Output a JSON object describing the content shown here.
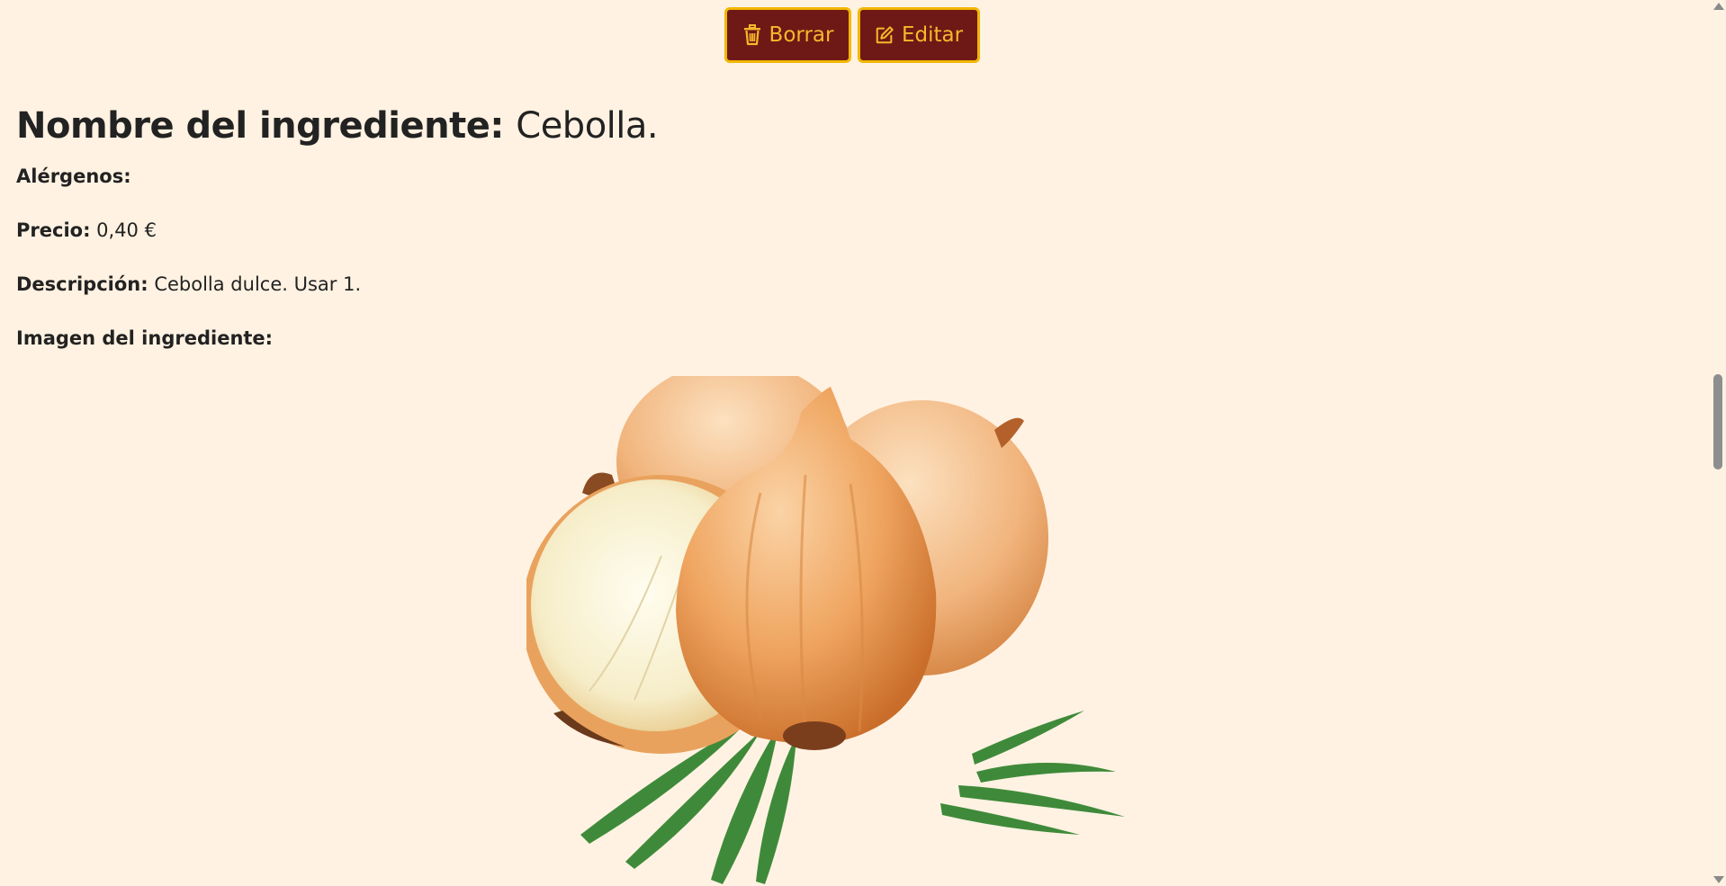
{
  "actions": {
    "delete_label": "Borrar",
    "edit_label": "Editar",
    "delete_icon": "trash-icon",
    "edit_icon": "edit-icon"
  },
  "ingredient": {
    "name_label": "Nombre del ingrediente:",
    "name_value": "Cebolla.",
    "allergens_label": "Alérgenos:",
    "allergens_value": "",
    "price_label": "Precio:",
    "price_value": "0,40 €",
    "description_label": "Descripción:",
    "description_value": "Cebolla dulce. Usar 1.",
    "image_label": "Imagen del ingrediente:"
  },
  "colors": {
    "background": "#FFF2E2",
    "button_bg": "#6E1916",
    "button_border": "#F2B705",
    "button_text": "#F7B82B"
  }
}
